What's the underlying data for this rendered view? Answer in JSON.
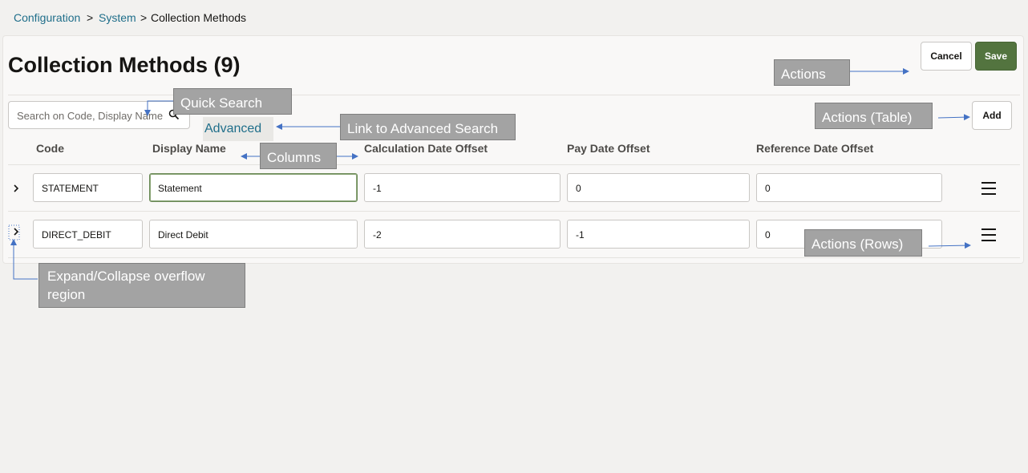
{
  "breadcrumb": {
    "items": [
      "Configuration",
      "System",
      "Collection Methods"
    ],
    "separator": ">"
  },
  "page": {
    "title": "Collection Methods (9)"
  },
  "actions": {
    "cancel_label": "Cancel",
    "save_label": "Save",
    "add_label": "Add"
  },
  "search": {
    "placeholder": "Search on Code, Display Name",
    "advanced_label": "Advanced"
  },
  "table": {
    "columns": [
      "Code",
      "Display Name",
      "Calculation Date Offset",
      "Pay Date Offset",
      "Reference Date Offset"
    ],
    "rows": [
      {
        "code": "STATEMENT",
        "display_name": "Statement",
        "calc_offset": "-1",
        "pay_offset": "0",
        "ref_offset": "0"
      },
      {
        "code": "DIRECT_DEBIT",
        "display_name": "Direct Debit",
        "calc_offset": "-2",
        "pay_offset": "-1",
        "ref_offset": "0"
      }
    ]
  },
  "annotations": {
    "actions": "Actions",
    "quick_search": "Quick Search",
    "link_advanced": "Link to Advanced Search",
    "actions_table": "Actions (Table)",
    "columns": "Columns",
    "actions_rows": "Actions (Rows)",
    "expand_line1": "Expand/Collapse overflow",
    "expand_line2": "region"
  },
  "colors": {
    "accent": "#53743f",
    "link": "#1f6e8a",
    "annotation": "#a3a3a3",
    "arrow": "#4472c4"
  }
}
